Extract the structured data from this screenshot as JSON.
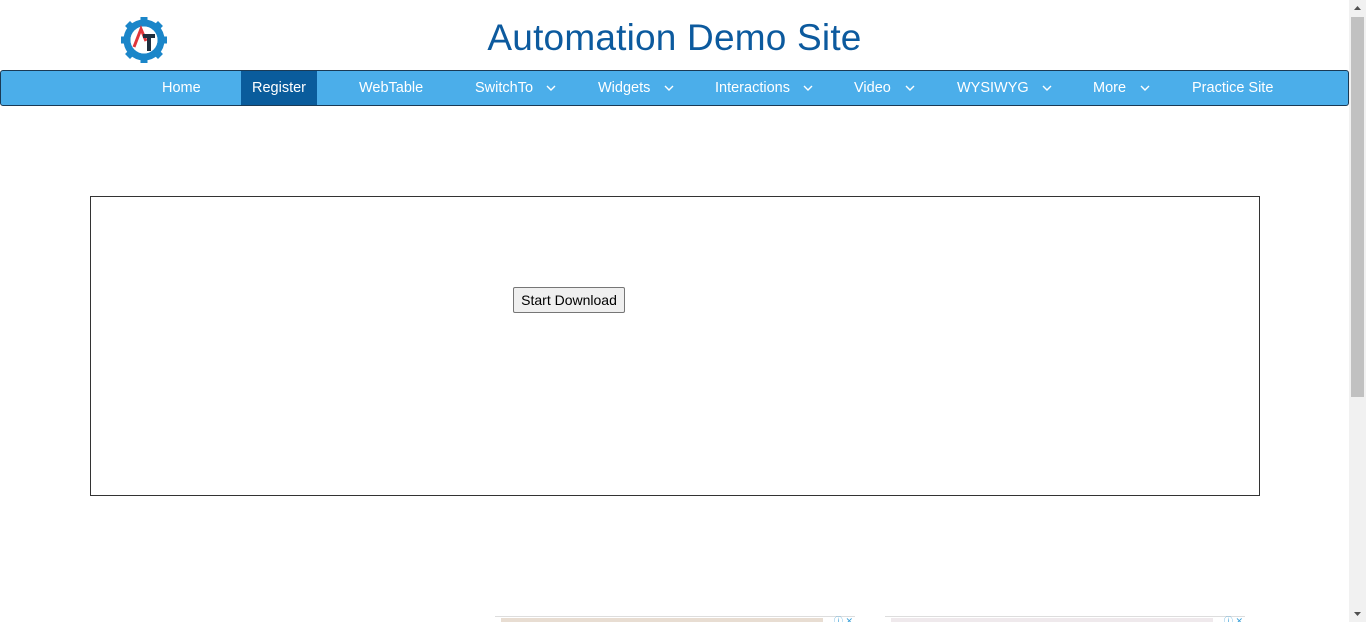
{
  "header": {
    "title": "Automation Demo Site"
  },
  "nav": {
    "items": [
      {
        "label": "Home",
        "has_dropdown": false,
        "active": false
      },
      {
        "label": "Register",
        "has_dropdown": false,
        "active": true
      },
      {
        "label": "WebTable",
        "has_dropdown": false,
        "active": false
      },
      {
        "label": "SwitchTo",
        "has_dropdown": true,
        "active": false
      },
      {
        "label": "Widgets",
        "has_dropdown": true,
        "active": false
      },
      {
        "label": "Interactions",
        "has_dropdown": true,
        "active": false
      },
      {
        "label": "Video",
        "has_dropdown": true,
        "active": false
      },
      {
        "label": "WYSIWYG",
        "has_dropdown": true,
        "active": false
      },
      {
        "label": "More",
        "has_dropdown": true,
        "active": false
      },
      {
        "label": "Practice Site",
        "has_dropdown": false,
        "active": false
      }
    ]
  },
  "main": {
    "download_button_label": "Start Download"
  },
  "colors": {
    "title": "#0c5a9e",
    "nav_background": "#4baeea",
    "nav_active": "#0a5c9c",
    "logo_gear": "#1b86c9",
    "logo_accent": "#e0353b"
  },
  "icons": {
    "logo": "gear-logo-icon",
    "dropdown": "chevron-down-icon",
    "ad_info": "info-icon",
    "ad_close": "close-icon"
  }
}
